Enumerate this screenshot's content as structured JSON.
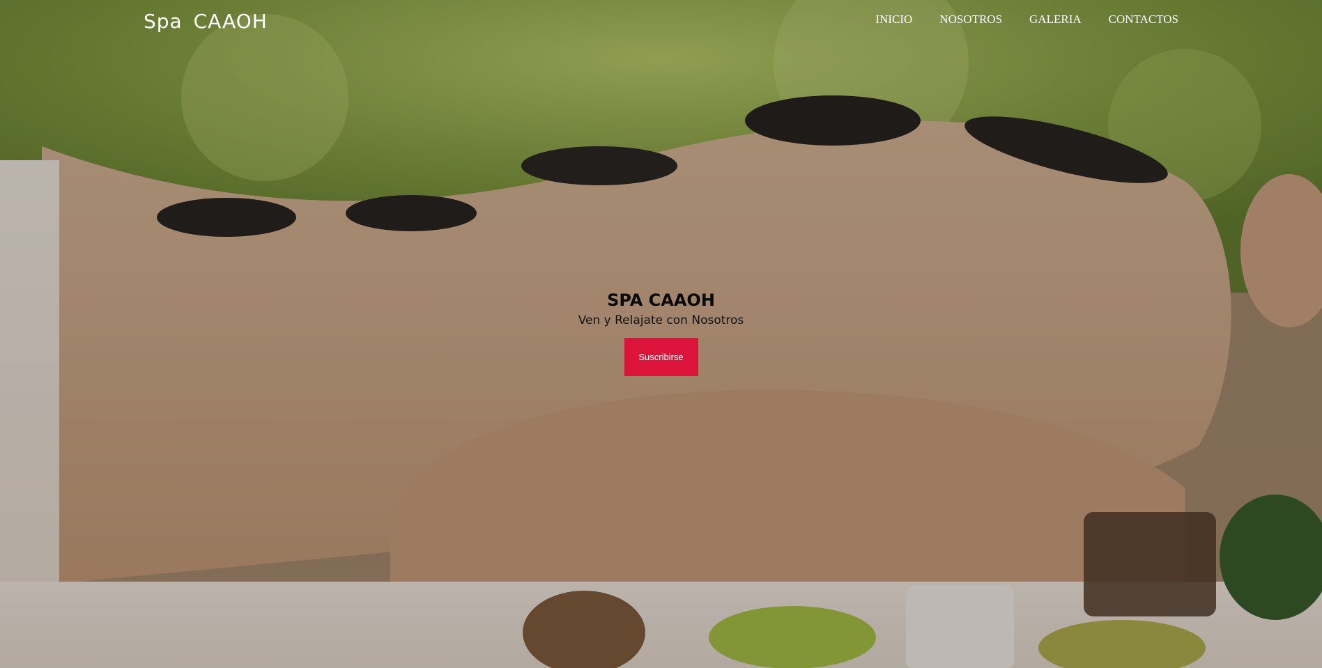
{
  "header": {
    "brand": "Spa  CAAOH",
    "nav": [
      {
        "label": "INICIO"
      },
      {
        "label": "NOSOTROS"
      },
      {
        "label": "GALERIA"
      },
      {
        "label": "CONTACTOS"
      }
    ]
  },
  "hero": {
    "title": "SPA CAAOH",
    "subtitle": "Ven y Relajate con Nosotros",
    "button_label": "Suscribirse",
    "accent_color": "#dc143c"
  }
}
